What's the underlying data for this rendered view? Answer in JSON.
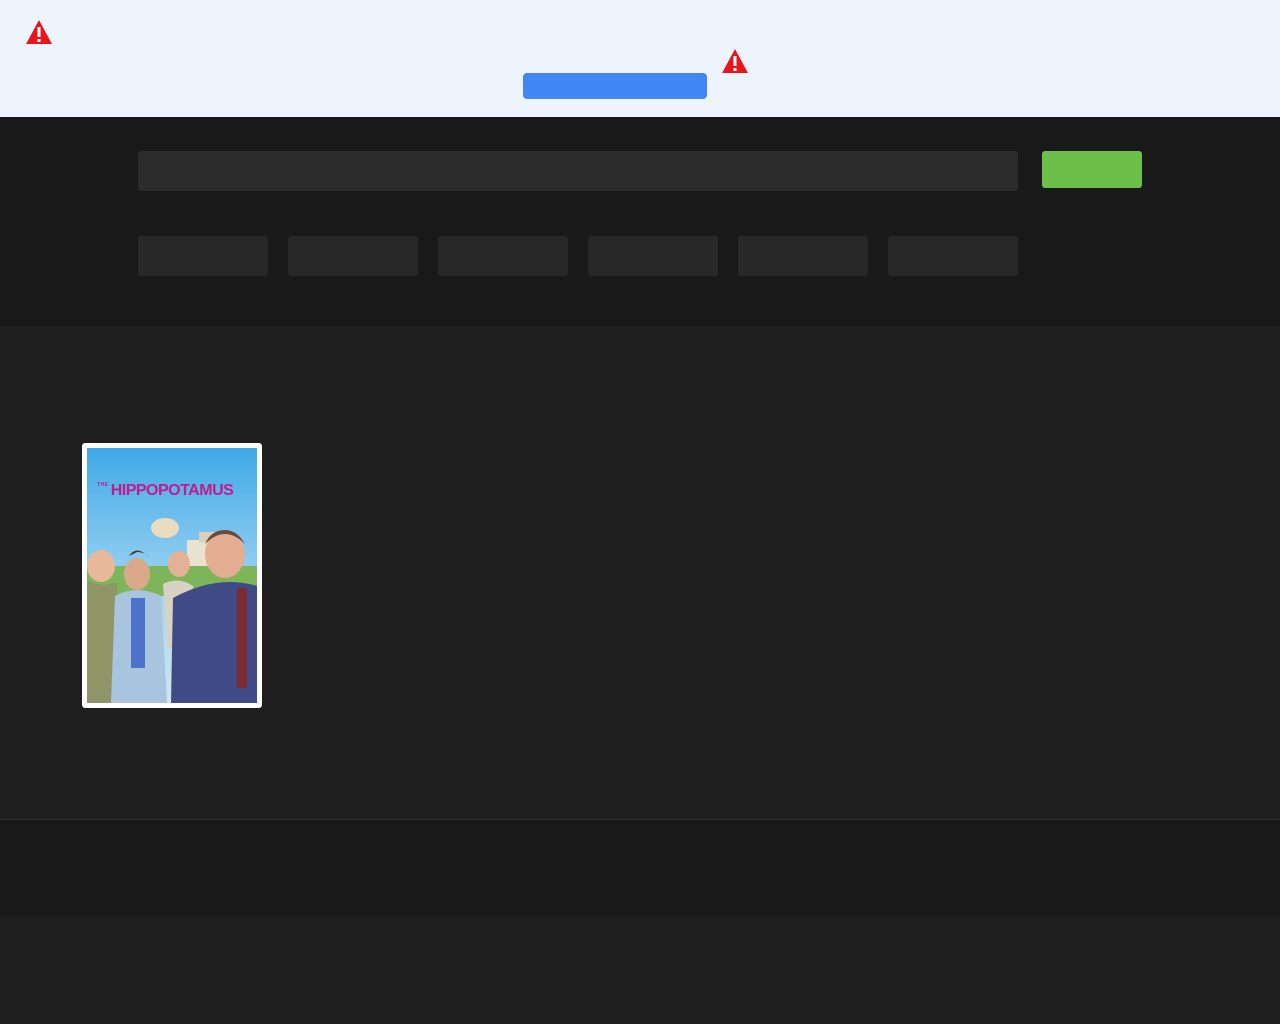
{
  "alert": {
    "button_label": "",
    "icon_left": "warning-icon",
    "icon_right": "warning-icon",
    "colors": {
      "background": "#eef4fd",
      "button": "#4285f4",
      "warning": "#e8161c"
    }
  },
  "header": {
    "search": {
      "placeholder": "",
      "value": ""
    },
    "search_button_label": "",
    "filters": [
      {
        "label": ""
      },
      {
        "label": ""
      },
      {
        "label": ""
      },
      {
        "label": ""
      },
      {
        "label": ""
      },
      {
        "label": ""
      }
    ],
    "colors": {
      "background": "#191919",
      "search_button": "#6cc04a"
    }
  },
  "results": [
    {
      "poster_title_small": "THE",
      "poster_title": "HIPPOPOTAMUS"
    }
  ],
  "footer": {
    "text": ""
  }
}
